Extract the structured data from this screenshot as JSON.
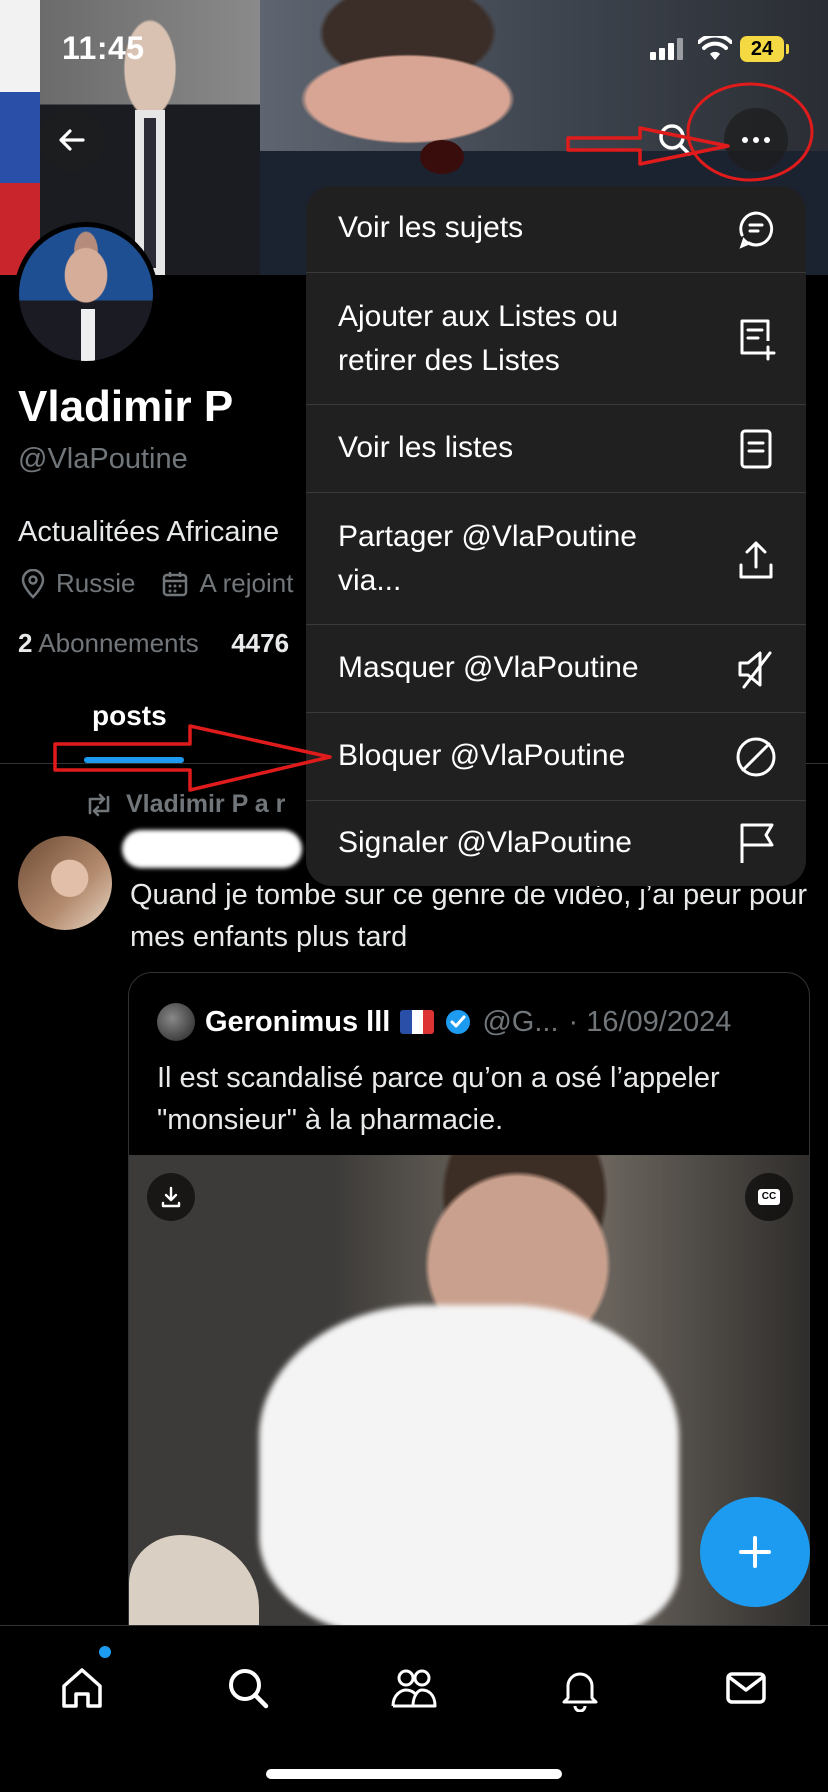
{
  "status_bar": {
    "time": "11:45",
    "battery": "24"
  },
  "profile": {
    "name": "Vladimir P",
    "handle": "@VlaPoutine",
    "bio": "Actualitées Africaine",
    "location": "Russie",
    "joined": "A rejoint",
    "following_count": "2",
    "following_label": "Abonnements",
    "followers_count": "4476"
  },
  "tabs": [
    {
      "label": "posts"
    }
  ],
  "post": {
    "repost_label": "Vladimir P a r",
    "text": "Quand je tombe sur ce genre de vidéo, j’ai peur pour mes enfants plus tard",
    "quote": {
      "name": "Geronimus lll",
      "handle": "@G...",
      "date": "· 16/09/2024",
      "text": "Il est scandalisé parce qu’on a osé l’appeler \"monsieur\" à la pharmacie."
    }
  },
  "menu": {
    "items": [
      {
        "label": "Voir les sujets",
        "icon": "topics-icon"
      },
      {
        "label": "Ajouter aux Listes ou\nretirer des Listes",
        "icon": "list-add-icon"
      },
      {
        "label": "Voir les listes",
        "icon": "list-icon"
      },
      {
        "label": "Partager @VlaPoutine\nvia...",
        "icon": "share-icon"
      },
      {
        "label": "Masquer @VlaPoutine",
        "icon": "mute-icon"
      },
      {
        "label": "Bloquer @VlaPoutine",
        "icon": "block-icon"
      },
      {
        "label": "Signaler @VlaPoutine",
        "icon": "flag-icon"
      }
    ]
  },
  "bottom_nav": [
    "home-icon",
    "search-icon",
    "communities-icon",
    "notifications-icon",
    "messages-icon"
  ],
  "colors": {
    "accent": "#1d9bf0",
    "annotation": "#e01b1b",
    "menu_bg": "#202020"
  }
}
